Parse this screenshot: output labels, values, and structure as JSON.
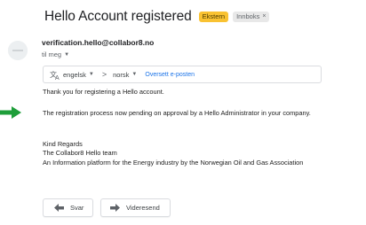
{
  "email": {
    "subject": "Hello Account registered",
    "labels": {
      "external": "Ekstern",
      "inbox": "Innboks",
      "inbox_remove": "×"
    },
    "sender": "verification.hello@collabor8.no",
    "to": "til meg",
    "translate": {
      "source_lang": "engelsk",
      "arrow": ">",
      "target_lang": "norsk",
      "link": "Oversett e-posten"
    },
    "body": {
      "line1": "Thank you for registering a Hello account.",
      "line2": "The registration process now pending on approval by a Hello Administrator in your company.",
      "line3": "Kind Regards",
      "line4": "The Collabor8 Hello team",
      "line5": "An Information platform for the Energy industry by the Norwegian Oil and Gas Association"
    },
    "actions": {
      "reply": "Svar",
      "forward": "Videresend"
    }
  },
  "colors": {
    "external_label": "#f9c232",
    "link": "#1a73e8",
    "annotation_arrow": "#1e9e3a"
  },
  "icons": [
    "avatar-icon",
    "translate-icon",
    "reply-icon",
    "forward-icon",
    "annotation-arrow"
  ]
}
